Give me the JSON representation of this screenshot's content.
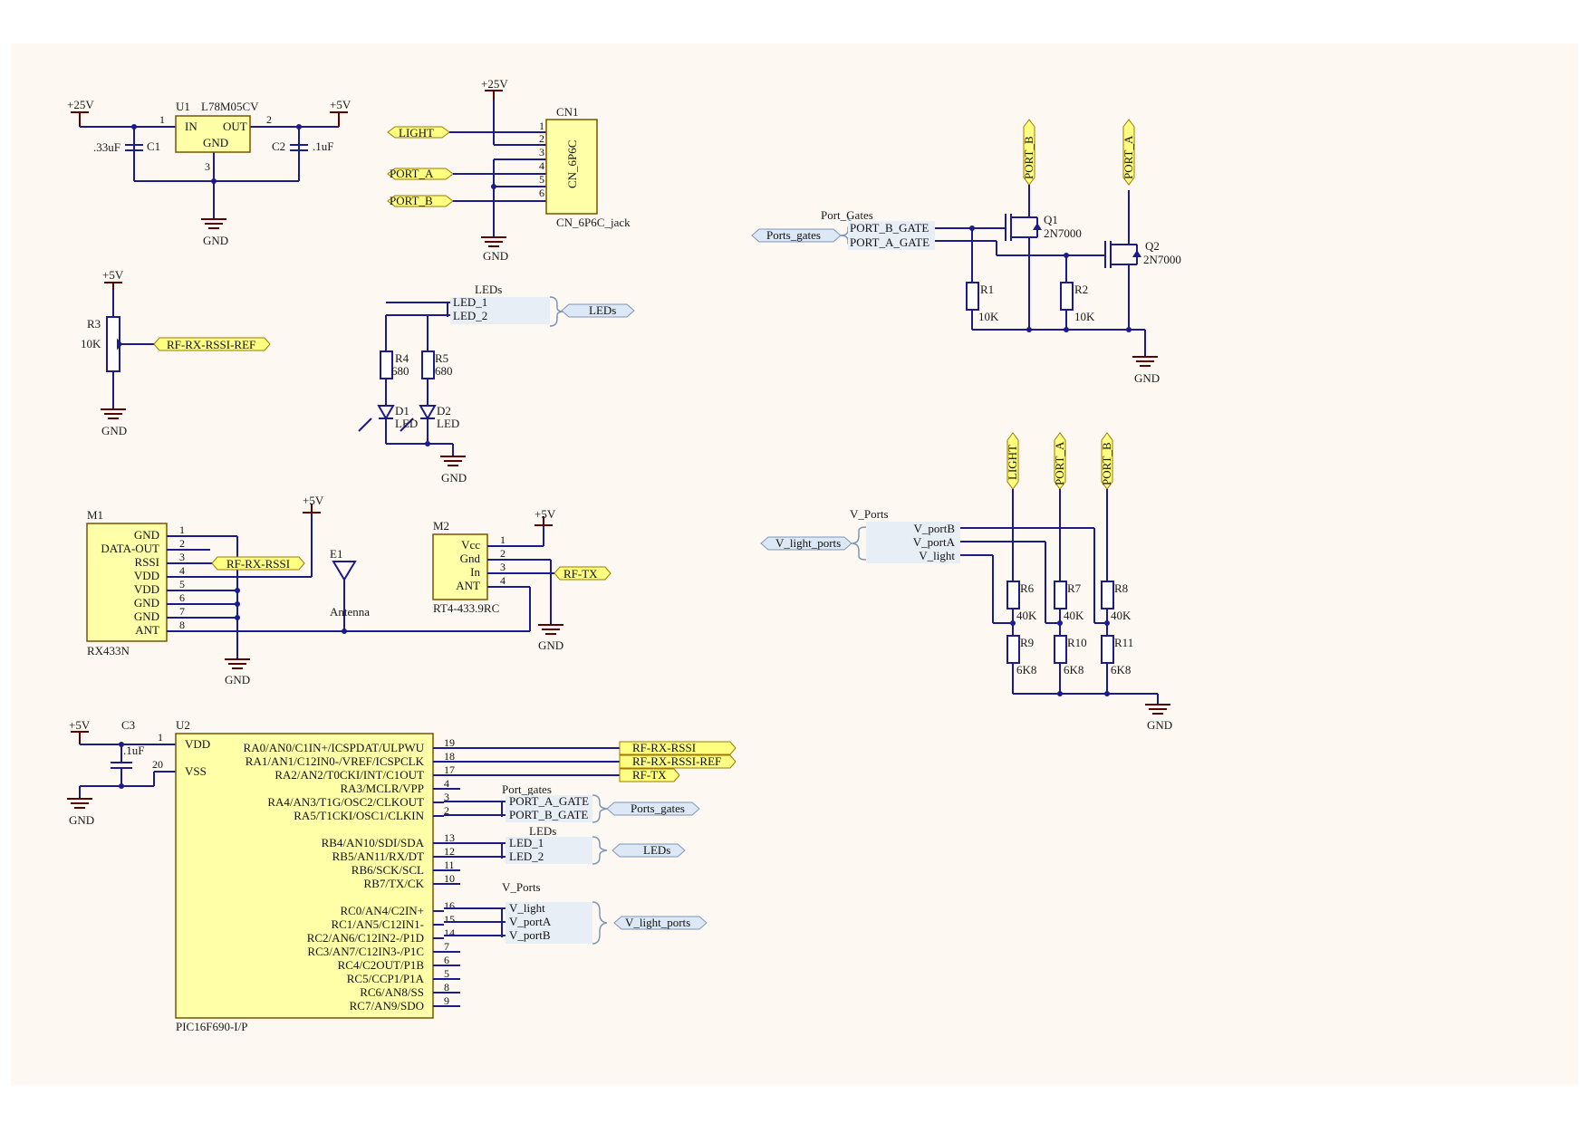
{
  "power": {
    "p25v": "+25V",
    "p5v": "+5V",
    "gnd": "GND"
  },
  "regulator": {
    "ref": "U1",
    "part": "L78M05CV",
    "pin_in": "IN",
    "pin_out": "OUT",
    "pin_gnd": "GND",
    "pin1": "1",
    "pin2": "2",
    "pin3": "3",
    "c1_ref": "C1",
    "c1_val": ".33uF",
    "c2_ref": "C2",
    "c2_val": ".1uF"
  },
  "connector": {
    "ref": "CN1",
    "body": "CN_6P6C",
    "part": "CN_6P6C_jack",
    "pins": [
      "1",
      "2",
      "3",
      "4",
      "5",
      "6"
    ],
    "nets": [
      "LIGHT",
      "PORT_A",
      "PORT_B"
    ]
  },
  "pot": {
    "ref": "R3",
    "val": "10K",
    "net": "RF-RX-RSSI-REF"
  },
  "leds": {
    "bus": "LEDs",
    "bus_label": "LEDs",
    "members": [
      "LED_1",
      "LED_2"
    ],
    "r4_ref": "R4",
    "r4_val": "680",
    "r5_ref": "R5",
    "r5_val": "680",
    "d1_ref": "D1",
    "d1_val": "LED",
    "d2_ref": "D2",
    "d2_val": "LED"
  },
  "mosfets": {
    "bus_label": "Ports_gates",
    "bus": "Port_Gates",
    "members": [
      "PORT_B_GATE",
      "PORT_A_GATE"
    ],
    "q1_ref": "Q1",
    "q1_val": "2N7000",
    "q2_ref": "Q2",
    "q2_val": "2N7000",
    "r1_ref": "R1",
    "r1_val": "10K",
    "r2_ref": "R2",
    "r2_val": "10K",
    "port_b": "PORT_B",
    "port_a": "PORT_A"
  },
  "receiver": {
    "ref": "M1",
    "part": "RX433N",
    "pins": [
      "GND",
      "DATA-OUT",
      "RSSI",
      "VDD",
      "VDD",
      "GND",
      "GND",
      "ANT"
    ],
    "nums": [
      "1",
      "2",
      "3",
      "4",
      "5",
      "6",
      "7",
      "8"
    ],
    "rssi_net": "RF-RX-RSSI",
    "antenna_ref": "E1",
    "antenna_label": "Antenna"
  },
  "transmitter": {
    "ref": "M2",
    "part": "RT4-433.9RC",
    "pins": [
      "Vcc",
      "Gnd",
      "In",
      "ANT"
    ],
    "nums": [
      "1",
      "2",
      "3",
      "4"
    ],
    "tx_net": "RF-TX"
  },
  "dividers": {
    "bus": "V_Ports",
    "bus_label": "V_light_ports",
    "members": [
      "V_portB",
      "V_portA",
      "V_light"
    ],
    "nets": [
      "LIGHT",
      "PORT_A",
      "PORT_B"
    ],
    "top": [
      {
        "ref": "R6",
        "val": "40K"
      },
      {
        "ref": "R7",
        "val": "40K"
      },
      {
        "ref": "R8",
        "val": "40K"
      }
    ],
    "bottom": [
      {
        "ref": "R9",
        "val": "6K8"
      },
      {
        "ref": "R10",
        "val": "6K8"
      },
      {
        "ref": "R11",
        "val": "6K8"
      }
    ]
  },
  "mcu": {
    "ref": "U2",
    "part": "PIC16F690-I/P",
    "c3_ref": "C3",
    "c3_val": ".1uF",
    "left_pins": [
      {
        "name": "VDD",
        "num": "1"
      },
      {
        "name": "VSS",
        "num": "20"
      }
    ],
    "right_pins": [
      {
        "name": "RA0/AN0/C1IN+/ICSPDAT/ULPWU",
        "num": "19"
      },
      {
        "name": "RA1/AN1/C12IN0-/VREF/ICSPCLK",
        "num": "18"
      },
      {
        "name": "RA2/AN2/T0CKI/INT/C1OUT",
        "num": "17"
      },
      {
        "name": "RA3/MCLR/VPP",
        "num": "4"
      },
      {
        "name": "RA4/AN3/T1G/OSC2/CLKOUT",
        "num": "3"
      },
      {
        "name": "RA5/T1CKI/OSC1/CLKIN",
        "num": "2"
      },
      {
        "name": "RB4/AN10/SDI/SDA",
        "num": "13"
      },
      {
        "name": "RB5/AN11/RX/DT",
        "num": "12"
      },
      {
        "name": "RB6/SCK/SCL",
        "num": "11"
      },
      {
        "name": "RB7/TX/CK",
        "num": "10"
      },
      {
        "name": "RC0/AN4/C2IN+",
        "num": "16"
      },
      {
        "name": "RC1/AN5/C12IN1-",
        "num": "15"
      },
      {
        "name": "RC2/AN6/C12IN2-/P1D",
        "num": "14"
      },
      {
        "name": "RC3/AN7/C12IN3-/P1C",
        "num": "7"
      },
      {
        "name": "RC4/C2OUT/P1B",
        "num": "6"
      },
      {
        "name": "RC5/CCP1/P1A",
        "num": "5"
      },
      {
        "name": "RC6/AN8/SS",
        "num": "8"
      },
      {
        "name": "RC7/AN9/SDO",
        "num": "9"
      }
    ],
    "nets": [
      "RF-RX-RSSI",
      "RF-RX-RSSI-REF",
      "RF-TX"
    ],
    "port_gates_bus": "Port_gates",
    "port_gates_members": [
      "PORT_A_GATE",
      "PORT_B_GATE"
    ],
    "port_gates_label": "Ports_gates",
    "leds_bus": "LEDs",
    "leds_members": [
      "LED_1",
      "LED_2"
    ],
    "leds_label": "LEDs",
    "vports_bus": "V_Ports",
    "vports_members": [
      "V_light",
      "V_portA",
      "V_portB"
    ],
    "vports_label": "V_light_ports"
  }
}
